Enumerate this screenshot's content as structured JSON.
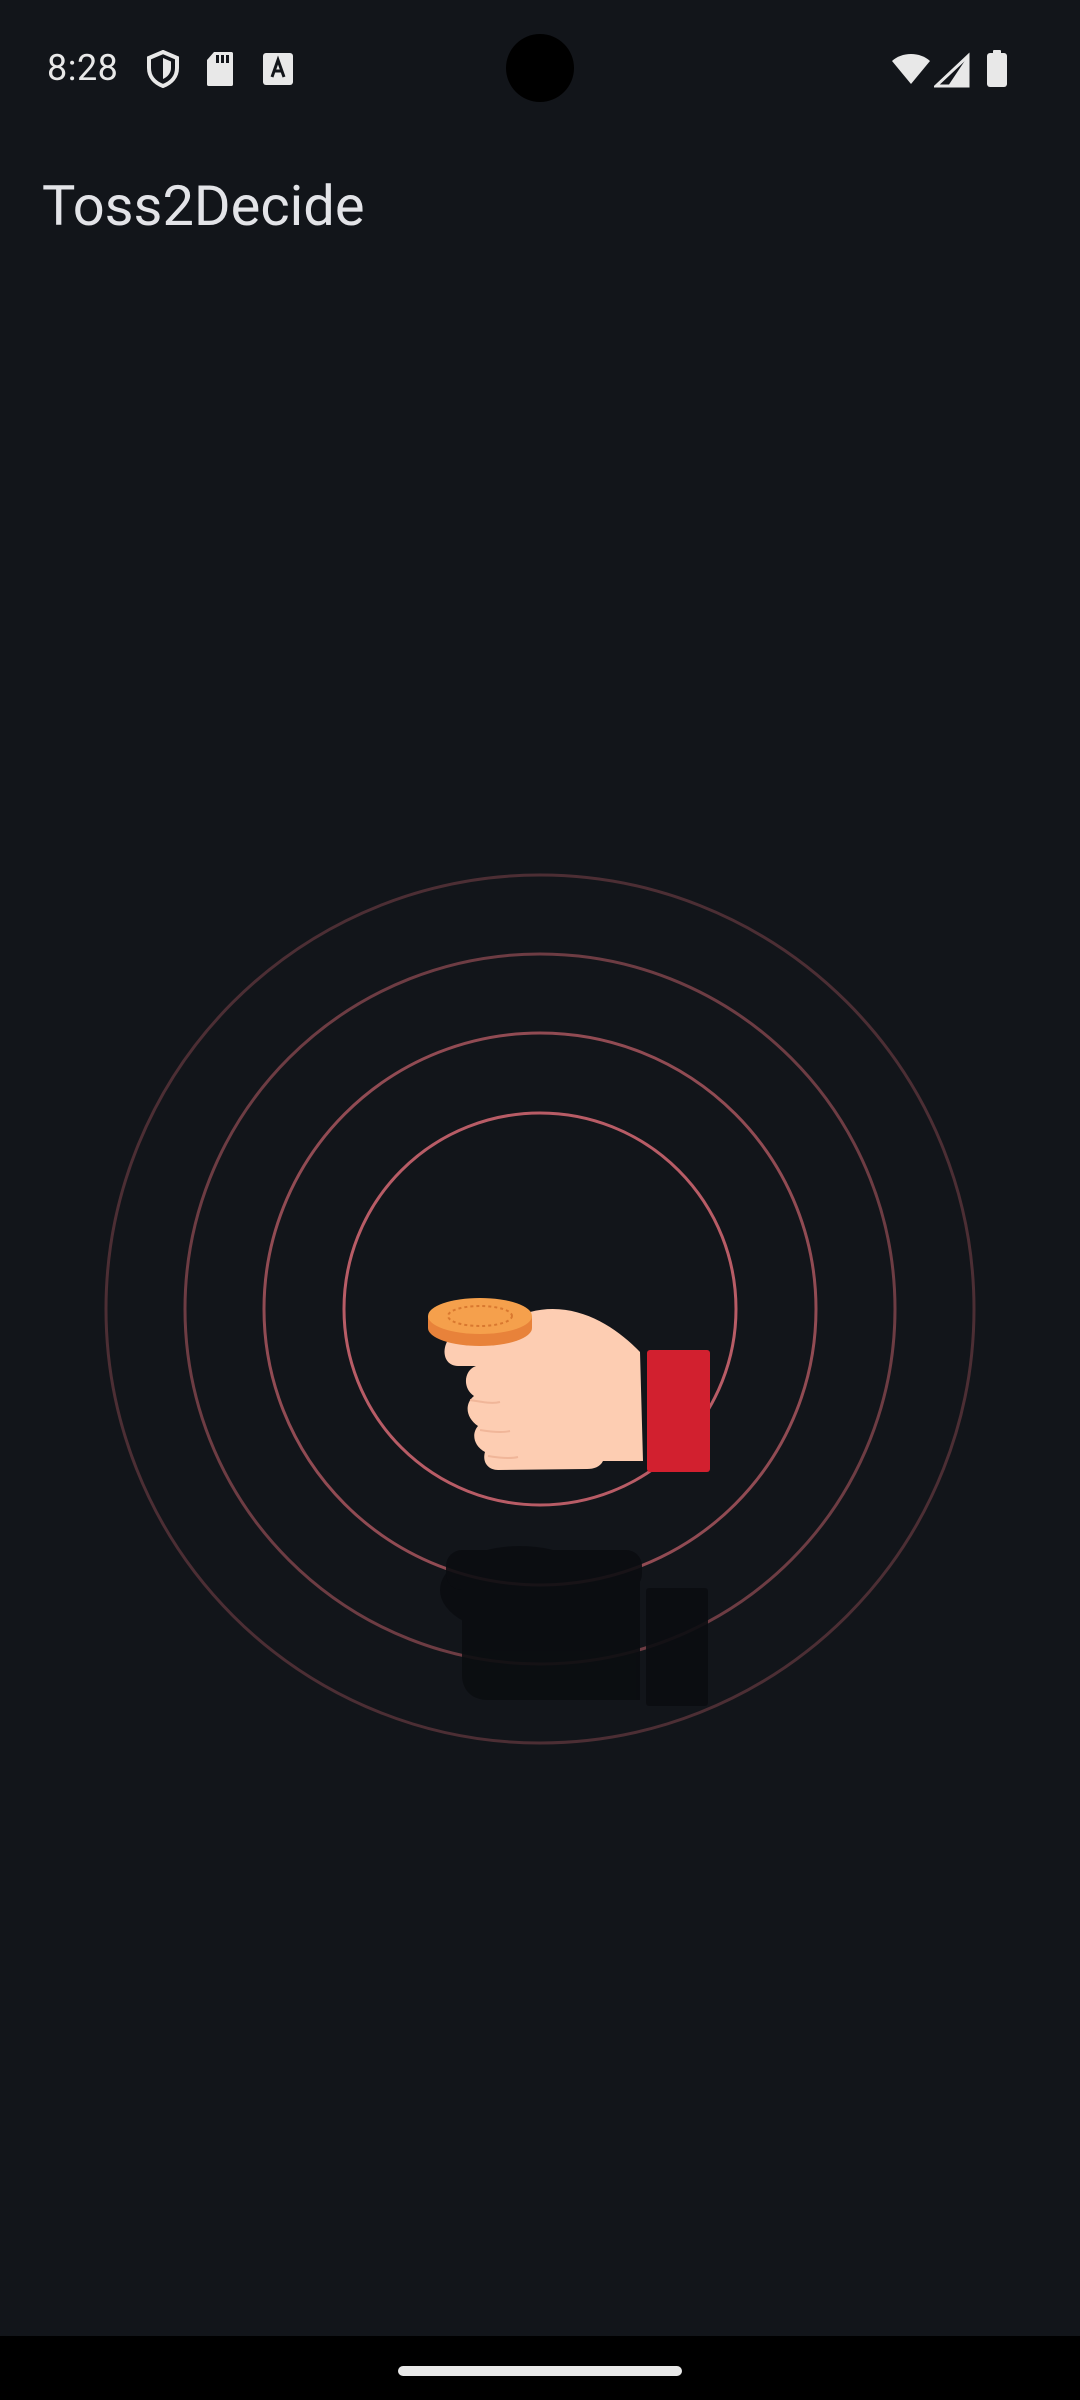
{
  "status_bar": {
    "time": "8:28",
    "icons_left": [
      "shield-icon",
      "sd-card-icon",
      "font-download-icon"
    ],
    "icons_right": [
      "wifi-icon",
      "cellular-signal-icon",
      "battery-icon"
    ]
  },
  "app_bar": {
    "title": "Toss2Decide"
  },
  "illustration": {
    "description_icon": "hand-flipping-coin-icon",
    "colors": {
      "ring": "#c7636c",
      "skin": "#fdcdb2",
      "sleeve": "#d2202f",
      "coin": "#f39a42",
      "shadow": "#0c0e12"
    }
  },
  "colors": {
    "background": "#12151a",
    "text_primary": "#e3e4e8"
  }
}
